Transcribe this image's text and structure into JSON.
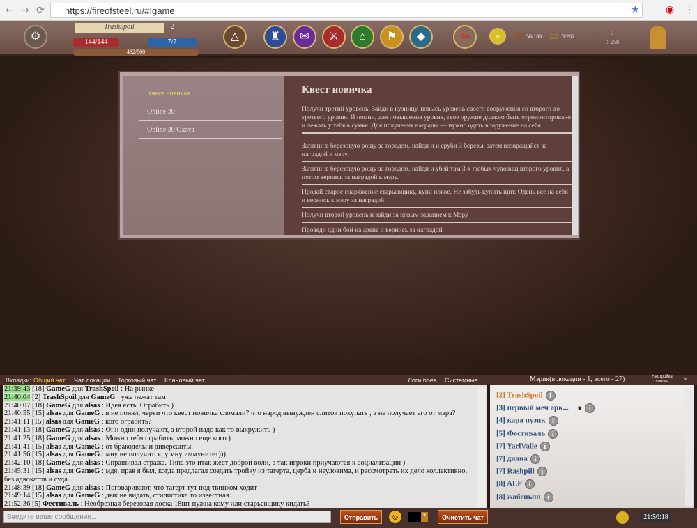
{
  "browser": {
    "url": "https://fireofsteel.ru/#!game",
    "back": "←",
    "forward": "→",
    "reload": "⟳"
  },
  "topbar": {
    "player_name": "TrashSpoil",
    "level": "2",
    "hp": "144/144",
    "mana": "7/7",
    "xp": "482/500",
    "bag": "58/100",
    "chest": "0/202",
    "gold": "0",
    "silver": "1 258"
  },
  "quests": {
    "list": [
      "Квест новичка",
      "Online 30",
      "Online 30 Охота"
    ],
    "title": "Квест новичка",
    "items": [
      "Получи третий уровень, Зайди в кузницу, повысь уровень своего вооружения со второго до третьего уровня. И помни, для повышения уровня, твое оружие должно быть отремонтировано и лежать у тебя в сумке. Для получения награды — нужно одеть вооружение на себя.",
      "Загляни в березовую рощу за городом, найди и и сруби 3 березы, затем возвращайся за наградой к мэру.",
      "Загляни в березовую рощу за городом, найди и убей там 3-х любых чудовищ второго уровня, а потом вернись за наградой к мэру.",
      "Продай старое снаряжение старьевщику, купи новое. Не забудь купить щит. Одень все на себя и вернись к мэру за наградой",
      "Получи второй уровень и зайди за новым заданием к Мэру",
      "Проведи один бой на арене и вернись за наградой"
    ]
  },
  "chat_tabs": {
    "label": "Вкладки:",
    "tabs": [
      "Общий чат",
      "Чат локации",
      "Торговый чат",
      "Клановый чат"
    ],
    "right": [
      "Логи боёв",
      "Системные"
    ],
    "location": "Мэрия(в локации - 1, всего - 27)",
    "settings": "Настройка списка"
  },
  "chat": [
    {
      "t": "21:39:43",
      "lvl": "[18]",
      "from": "GameG",
      "to": "TrashSpoil",
      "text": ": На рынке",
      "hl": true
    },
    {
      "t": "21:40:04",
      "lvl": "[2]",
      "from": "TrashSpoil",
      "to": "GameG",
      "text": ": уже лежат там",
      "hl": true
    },
    {
      "t": "21:40:07",
      "lvl": "[18]",
      "from": "GameG",
      "to": "alsas",
      "text": ": Идея есть. Ограбить )"
    },
    {
      "t": "21:40:55",
      "lvl": "[15]",
      "from": "alsas",
      "to": "GameG",
      "text": ": я не понял, черви что квест новичка сломали? что народ вынужден слиток покупать , а не получает его от мэра?"
    },
    {
      "t": "21:41:11",
      "lvl": "[15]",
      "from": "alsas",
      "to": "GameG",
      "text": ": кого ограбить?"
    },
    {
      "t": "21:41:13",
      "lvl": "[18]",
      "from": "GameG",
      "to": "alsas",
      "text": ": Они одни получают, а второй надо как то выкружить )"
    },
    {
      "t": "21:41:25",
      "lvl": "[18]",
      "from": "GameG",
      "to": "alsas",
      "text": ": Можно тебя ограбить, можно еще кого )"
    },
    {
      "t": "21:41:41",
      "lvl": "[15]",
      "from": "alsas",
      "to": "GameG",
      "text": ": от бракоделы и диверсанты."
    },
    {
      "t": "21:41:56",
      "lvl": "[15]",
      "from": "alsas",
      "to": "GameG",
      "text": ": мну не получится, у мну иммунитет)))"
    },
    {
      "t": "21:42:10",
      "lvl": "[18]",
      "from": "GameG",
      "to": "alsas",
      "text": ": Спрашивал стража. Типа это итак жест доброй воли, а так игроки приучаются к социализации )"
    },
    {
      "t": "21:45:31",
      "lvl": "[15]",
      "from": "alsas",
      "to": "GameG",
      "text": ": мдя, прав я был, когда предлагал создать тройку из тагерта, церба и неуловима, и рассмотреть их дело коллективно, без адвокатов и суда..."
    },
    {
      "t": "21:48:39",
      "lvl": "[18]",
      "from": "GameG",
      "to": "alsas",
      "text": ": Поговаривают, что тагерт тут под твинком ходит"
    },
    {
      "t": "21:49:14",
      "lvl": "[15]",
      "from": "alsas",
      "to": "GameG",
      "text": ": дык не видать, стилистика то известная."
    },
    {
      "t": "21:52:36",
      "lvl": "[5]",
      "from": "Фестиваль",
      "to": "",
      "text": ": Необрезная березовая доска 18шт нужна кому или старьевщику кидать?"
    }
  ],
  "to_word": "для",
  "users": [
    {
      "lvl": "[2]",
      "name": "TrashSpoil",
      "self": true
    },
    {
      "lvl": "[3]",
      "name": "первый меч арк..."
    },
    {
      "lvl": "[4]",
      "name": "кара пузик"
    },
    {
      "lvl": "[5]",
      "name": "Фестиваль"
    },
    {
      "lvl": "[7]",
      "name": "YarlValle"
    },
    {
      "lvl": "[7]",
      "name": "диана"
    },
    {
      "lvl": "[7]",
      "name": "Rashpill"
    },
    {
      "lvl": "[8]",
      "name": "ALF"
    },
    {
      "lvl": "[8]",
      "name": "жабеныш"
    }
  ],
  "input": {
    "placeholder": "Введите ваше сообщение..."
  },
  "buttons": {
    "send": "Отправить",
    "clear": "Очистить чат",
    "info": "i"
  },
  "clock": "21:56:18"
}
